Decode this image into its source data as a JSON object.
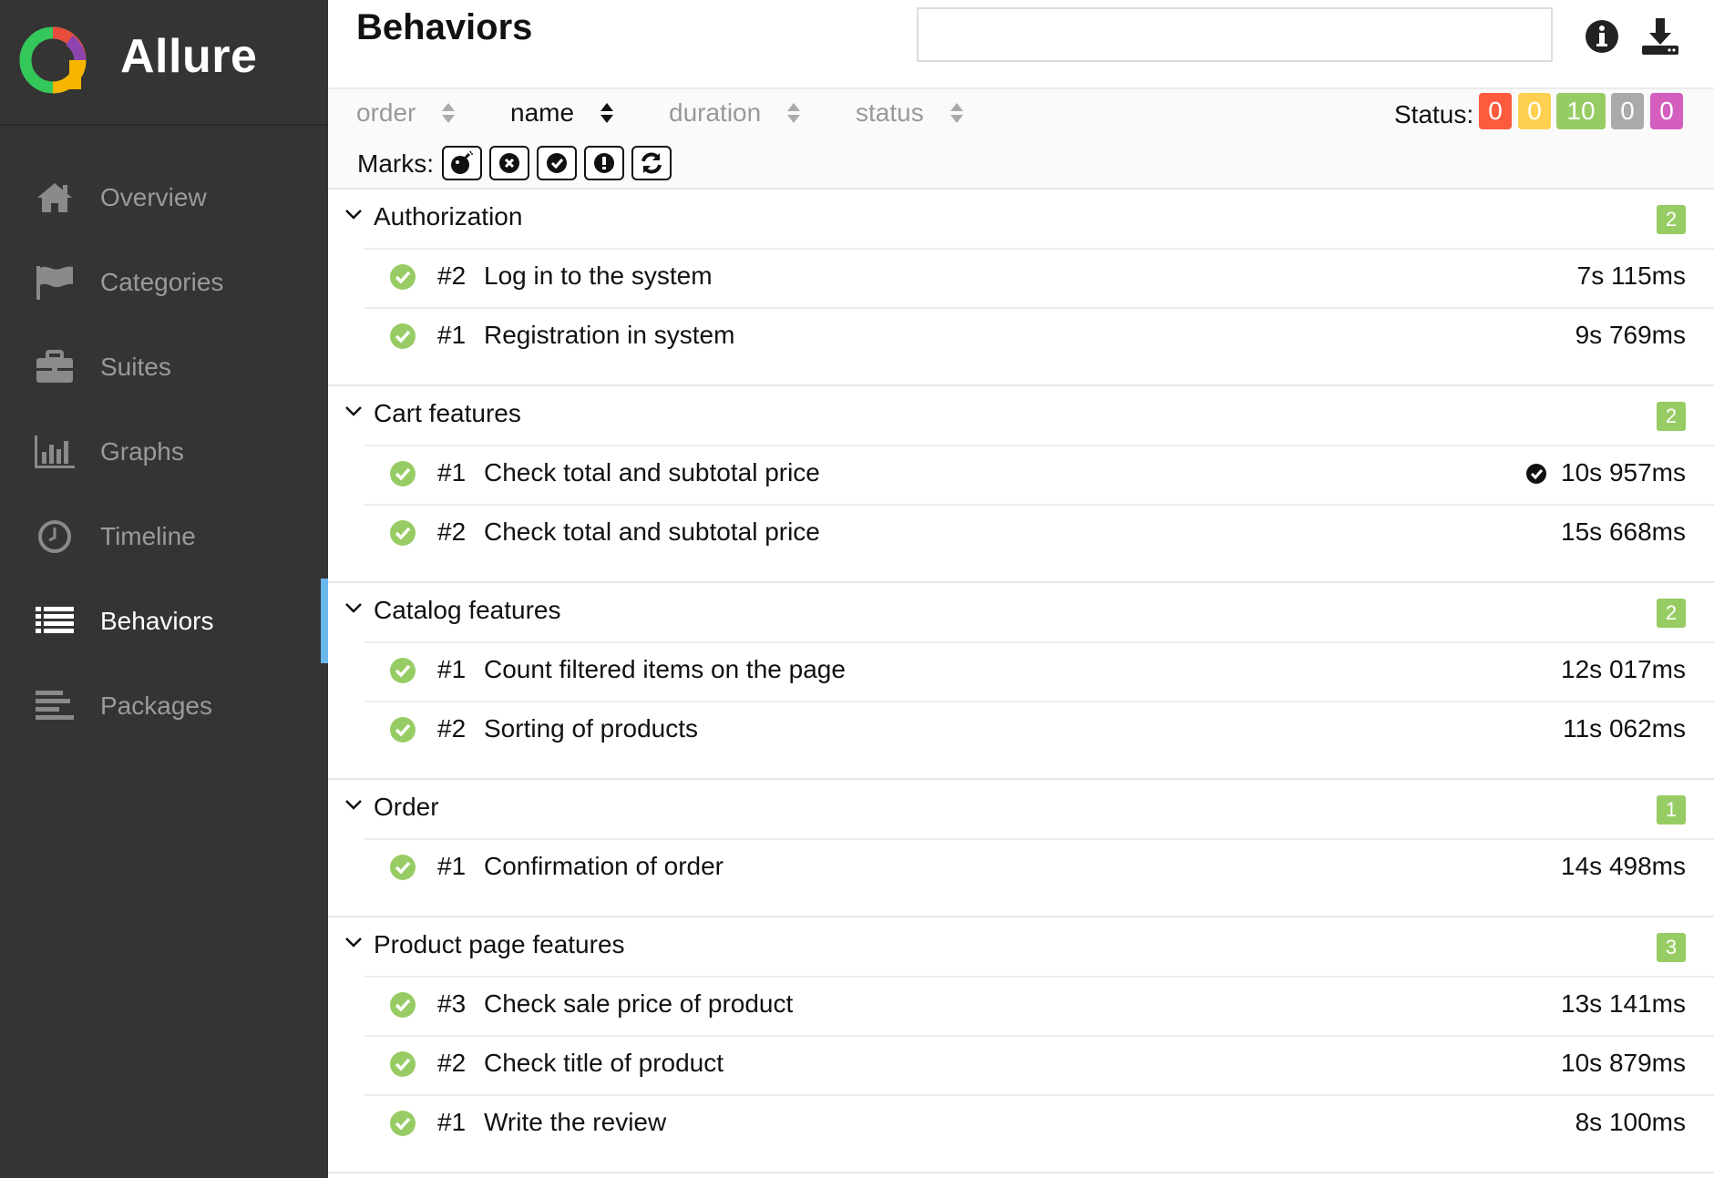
{
  "app": {
    "name": "Allure"
  },
  "sidebar": {
    "items": [
      {
        "label": "Overview",
        "icon": "home-icon"
      },
      {
        "label": "Categories",
        "icon": "flag-icon"
      },
      {
        "label": "Suites",
        "icon": "briefcase-icon"
      },
      {
        "label": "Graphs",
        "icon": "bar-chart-icon"
      },
      {
        "label": "Timeline",
        "icon": "clock-icon"
      },
      {
        "label": "Behaviors",
        "icon": "list-icon",
        "active": true
      },
      {
        "label": "Packages",
        "icon": "align-left-icon"
      }
    ],
    "active_color": "#6ab7ee"
  },
  "header": {
    "title": "Behaviors",
    "search_value": "",
    "info_icon": "info-icon",
    "download_icon": "download-icon"
  },
  "sort": {
    "order": "order",
    "name": "name",
    "duration": "duration",
    "status": "status",
    "active": "name"
  },
  "status_filter": {
    "label": "Status:",
    "badges": [
      {
        "value": "0",
        "kind": "failed",
        "color": "#fd5a3e"
      },
      {
        "value": "0",
        "kind": "broken",
        "color": "#ffd050"
      },
      {
        "value": "10",
        "kind": "passed",
        "color": "#97cc64"
      },
      {
        "value": "0",
        "kind": "skipped",
        "color": "#aaaaaa"
      },
      {
        "value": "0",
        "kind": "unknown",
        "color": "#d35ebe"
      }
    ]
  },
  "marks": {
    "label": "Marks:",
    "items": [
      "bomb-icon",
      "times-circle-icon",
      "check-circle-icon",
      "exclamation-circle-icon",
      "refresh-icon"
    ]
  },
  "groups": [
    {
      "name": "Authorization",
      "count": "2",
      "tests": [
        {
          "num": "#2",
          "name": "Log in to the system",
          "duration": "7s 115ms"
        },
        {
          "num": "#1",
          "name": "Registration in system",
          "duration": "9s 769ms"
        }
      ]
    },
    {
      "name": "Cart features",
      "count": "2",
      "tests": [
        {
          "num": "#1",
          "name": "Check total and subtotal price",
          "duration": "10s 957ms",
          "flaky": true
        },
        {
          "num": "#2",
          "name": "Check total and subtotal price",
          "duration": "15s 668ms"
        }
      ]
    },
    {
      "name": "Catalog features",
      "count": "2",
      "tests": [
        {
          "num": "#1",
          "name": "Count filtered items on the page",
          "duration": "12s 017ms"
        },
        {
          "num": "#2",
          "name": "Sorting of products",
          "duration": "11s 062ms"
        }
      ]
    },
    {
      "name": "Order",
      "count": "1",
      "tests": [
        {
          "num": "#1",
          "name": "Confirmation of order",
          "duration": "14s 498ms"
        }
      ]
    },
    {
      "name": "Product page features",
      "count": "3",
      "tests": [
        {
          "num": "#3",
          "name": "Check sale price of product",
          "duration": "13s 141ms"
        },
        {
          "num": "#2",
          "name": "Check title of product",
          "duration": "10s 879ms"
        },
        {
          "num": "#1",
          "name": "Write the review",
          "duration": "8s 100ms"
        }
      ]
    }
  ]
}
